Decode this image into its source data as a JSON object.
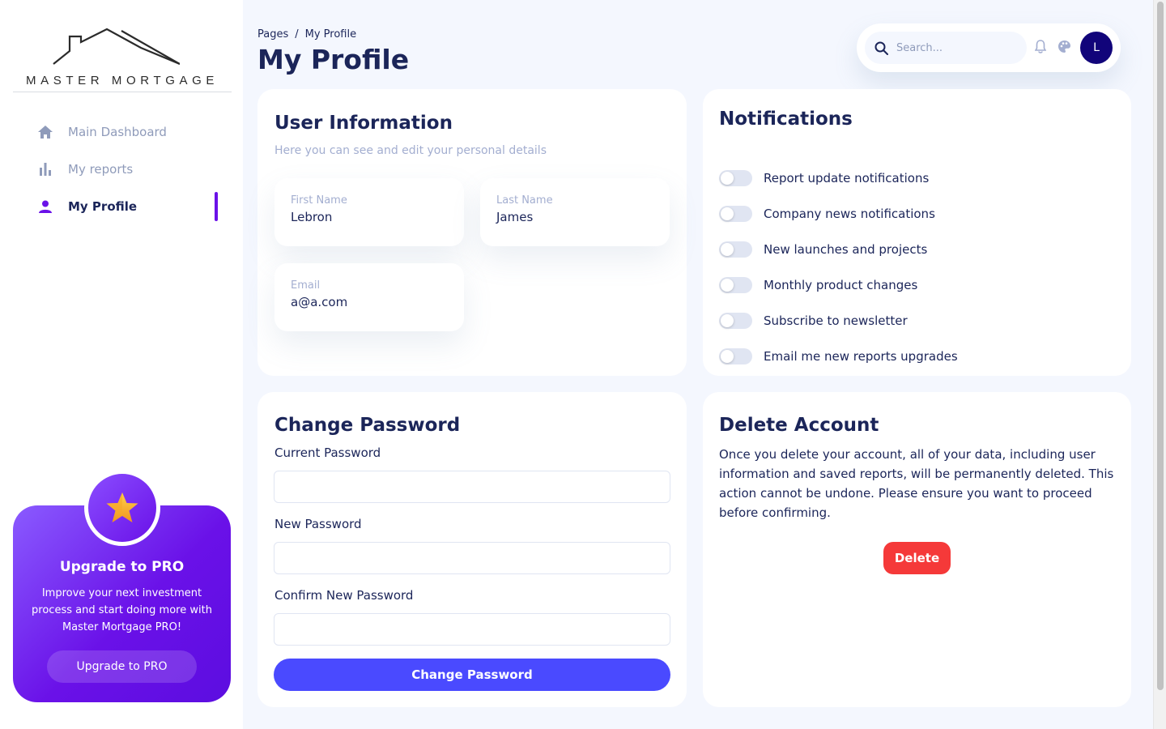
{
  "brand": {
    "name": "MASTER MORTGAGE"
  },
  "sidebar": {
    "items": [
      {
        "label": "Main Dashboard",
        "icon": "home-icon",
        "active": false
      },
      {
        "label": "My reports",
        "icon": "bar-chart-icon",
        "active": false
      },
      {
        "label": "My Profile",
        "icon": "person-icon",
        "active": true
      }
    ],
    "promo": {
      "title": "Upgrade to PRO",
      "text": "Improve your next investment process and start doing more with Master Mortgage PRO!",
      "button": "Upgrade to PRO",
      "icon": "star-icon"
    }
  },
  "header": {
    "breadcrumb": [
      "Pages",
      "My Profile"
    ],
    "breadcrumb_separator": "/",
    "title": "My Profile"
  },
  "topbar": {
    "search_placeholder": "Search...",
    "avatar_initial": "L"
  },
  "user_info": {
    "title": "User Information",
    "subtitle": "Here you can see and edit your personal details",
    "fields": [
      {
        "label": "First Name",
        "value": "Lebron"
      },
      {
        "label": "Last Name",
        "value": "James"
      },
      {
        "label": "Email",
        "value": "a@a.com"
      }
    ]
  },
  "notifications": {
    "title": "Notifications",
    "items": [
      {
        "label": "Report update notifications",
        "enabled": false
      },
      {
        "label": "Company news notifications",
        "enabled": false
      },
      {
        "label": "New launches and projects",
        "enabled": false
      },
      {
        "label": "Monthly product changes",
        "enabled": false
      },
      {
        "label": "Subscribe to newsletter",
        "enabled": false
      },
      {
        "label": "Email me new reports upgrades",
        "enabled": false
      }
    ]
  },
  "change_password": {
    "title": "Change Password",
    "current_label": "Current Password",
    "new_label": "New Password",
    "confirm_label": "Confirm New Password",
    "button": "Change Password"
  },
  "delete_account": {
    "title": "Delete Account",
    "text": "Once you delete your account, all of your data, including user information and saved reports, will be permanently deleted. This action cannot be undone. Please ensure you want to proceed before confirming.",
    "button": "Delete"
  },
  "colors": {
    "accent": "#6a11e8",
    "primary_button": "#4a4aff",
    "danger": "#f53939",
    "text": "#1b2559",
    "muted": "#a3aed0",
    "avatar_bg": "#11047a"
  }
}
